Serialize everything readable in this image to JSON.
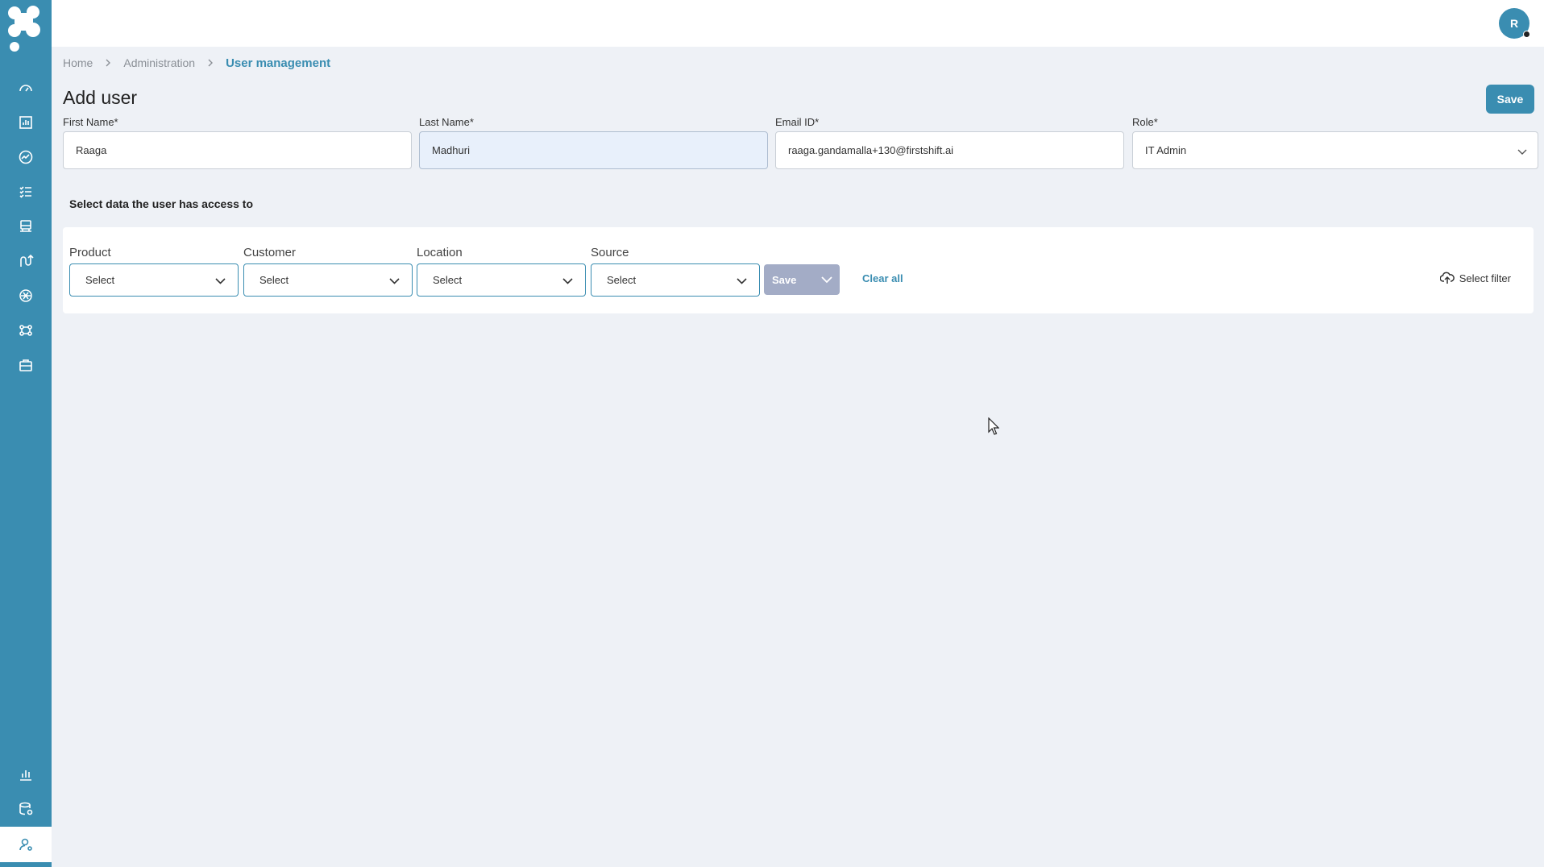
{
  "sidebar": {
    "items": [
      {
        "name": "dashboard-icon"
      },
      {
        "name": "analytics-icon"
      },
      {
        "name": "trend-icon"
      },
      {
        "name": "tasks-icon"
      },
      {
        "name": "transport-icon"
      },
      {
        "name": "route-icon"
      },
      {
        "name": "ai-icon"
      },
      {
        "name": "network-icon"
      },
      {
        "name": "briefcase-icon"
      },
      {
        "name": "reports-icon"
      },
      {
        "name": "data-settings-icon"
      },
      {
        "name": "user-admin-icon"
      }
    ],
    "accent_color": "#3a8db1"
  },
  "header": {
    "avatar_initial": "R"
  },
  "breadcrumb": {
    "home": "Home",
    "admin": "Administration",
    "current": "User management"
  },
  "page": {
    "title": "Add user",
    "save_label": "Save"
  },
  "form": {
    "first_name": {
      "label": "First Name*",
      "value": "Raaga"
    },
    "last_name": {
      "label": "Last Name*",
      "value": "Madhuri"
    },
    "email": {
      "label": "Email ID*",
      "value": "raaga.gandamalla+130@firstshift.ai"
    },
    "role": {
      "label": "Role*",
      "value": "IT Admin"
    }
  },
  "access": {
    "heading": "Select data the user has access to",
    "filters": [
      {
        "label": "Product",
        "value": "Select"
      },
      {
        "label": "Customer",
        "value": "Select"
      },
      {
        "label": "Location",
        "value": "Select"
      },
      {
        "label": "Source",
        "value": "Select"
      }
    ],
    "save_label": "Save",
    "clear_label": "Clear all",
    "select_filter_label": "Select filter"
  }
}
